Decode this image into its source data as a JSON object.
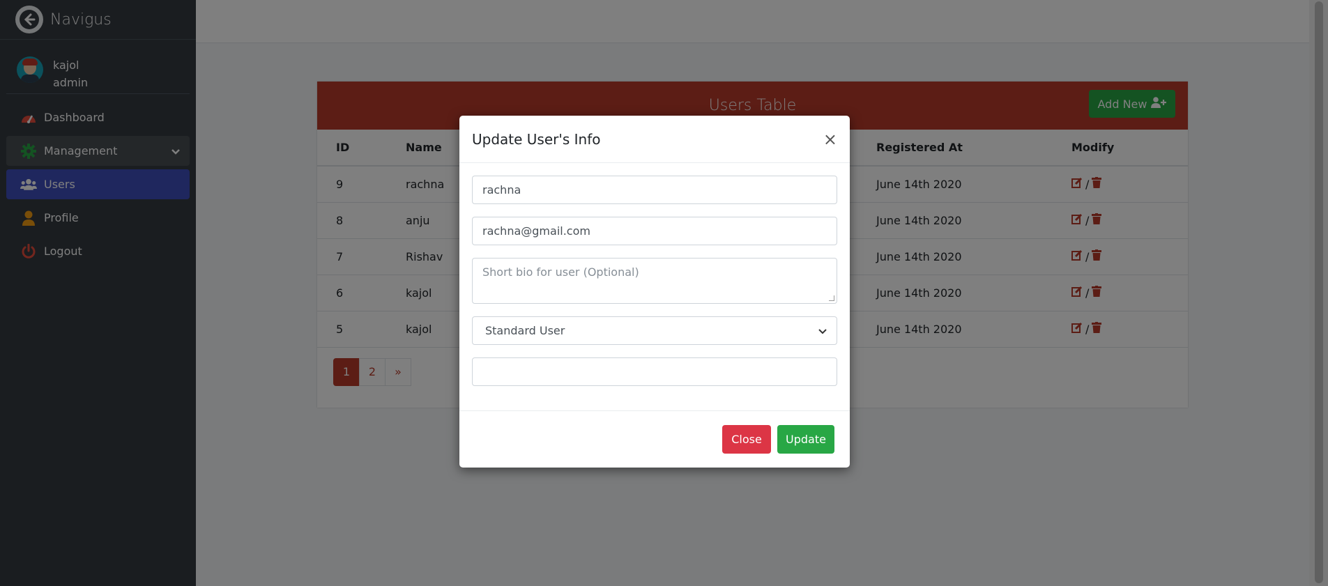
{
  "brand": {
    "title": "Navigus"
  },
  "user": {
    "name": "kajol",
    "role": "admin"
  },
  "nav": {
    "dashboard": "Dashboard",
    "management": "Management",
    "users": "Users",
    "profile": "Profile",
    "logout": "Logout"
  },
  "card": {
    "title": "Users Table",
    "add_label": "Add New",
    "columns": {
      "id": "ID",
      "name": "Name",
      "registered": "Registered At",
      "modify": "Modify"
    },
    "rows": [
      {
        "id": "9",
        "name": "rachna",
        "registered": "June 14th 2020"
      },
      {
        "id": "8",
        "name": "anju",
        "registered": "June 14th 2020"
      },
      {
        "id": "7",
        "name": "Rishav",
        "registered": "June 14th 2020"
      },
      {
        "id": "6",
        "name": "kajol",
        "registered": "June 14th 2020"
      },
      {
        "id": "5",
        "name": "kajol",
        "registered": "June 14th 2020"
      }
    ],
    "modify_sep": "/",
    "pages": [
      "1",
      "2",
      "»"
    ]
  },
  "modal": {
    "title": "Update User's Info",
    "close_symbol": "×",
    "name_value": "rachna",
    "email_value": "rachna@gmail.com",
    "bio_placeholder": "Short bio for user (Optional)",
    "role_selected": "Standard User",
    "password_value": "",
    "close_label": "Close",
    "update_label": "Update"
  },
  "colors": {
    "sidebar": "#343a40",
    "card_header": "#b83b2b",
    "active_nav": "#3f4fbd",
    "success": "#28a745",
    "danger": "#dc3545"
  }
}
